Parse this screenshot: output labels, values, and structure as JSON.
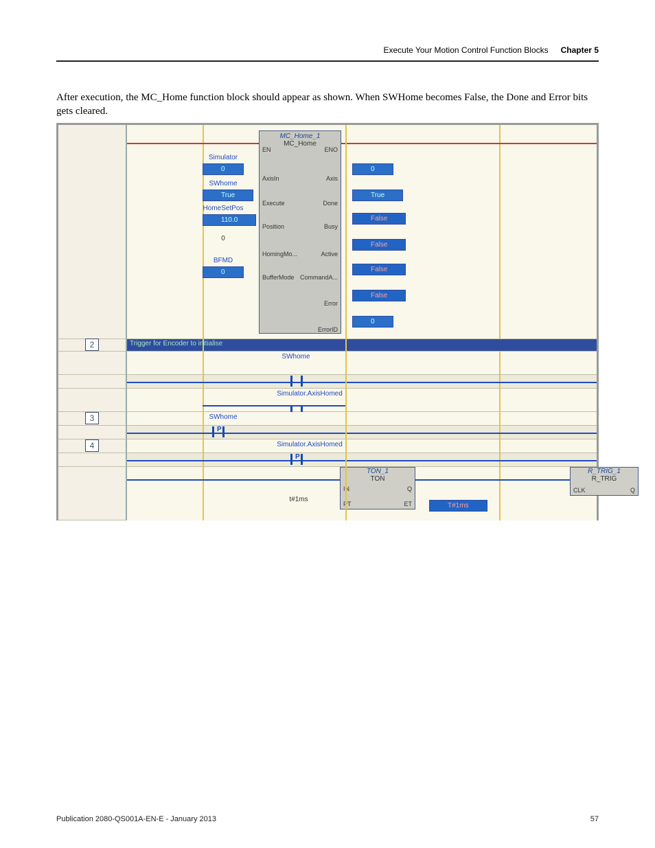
{
  "header": {
    "breadcrumb": "Execute Your Motion Control Function Blocks",
    "chapter": "Chapter 5"
  },
  "intro": "After execution, the MC_Home function block should appear as shown. When SWHome becomes False, the Done and Error bits gets cleared.",
  "mc_home": {
    "instance": "MC_Home_1",
    "type": "MC_Home",
    "ports_left": {
      "en": "EN",
      "axis": "AxisIn",
      "execute": "Execute",
      "position": "Position",
      "homing": "HomingMo...",
      "buffermode": "BufferMode"
    },
    "ports_right": {
      "eno": "ENO",
      "axis": "Axis",
      "done": "Done",
      "busy": "Busy",
      "active": "Active",
      "commanda": "CommandA...",
      "error": "Error",
      "errorid": "ErrorID"
    },
    "inputs": [
      {
        "label": "Simulator",
        "value": "0"
      },
      {
        "label": "SWhome",
        "value": "True"
      },
      {
        "label": "HomeSetPos",
        "value": "110.0"
      },
      {
        "label": "",
        "value": "0"
      },
      {
        "label": "BFMD",
        "value": "0"
      }
    ],
    "outputs": [
      {
        "value": "0"
      },
      {
        "value": "True"
      },
      {
        "value": "False"
      },
      {
        "value": "False"
      },
      {
        "value": "False"
      },
      {
        "value": "False"
      },
      {
        "value": "0"
      }
    ]
  },
  "rung2": {
    "num": "2",
    "note": "Trigger for Encoder to initialise",
    "contact1": "SWhome",
    "contact2": "Simulator.AxisHomed"
  },
  "rung3": {
    "num": "3",
    "contact": "SWhome"
  },
  "rung4": {
    "num": "4",
    "contact": "Simulator.AxisHomed",
    "tonInstance": "TON_1",
    "tonType": "TON",
    "tonPorts": {
      "in": "IN",
      "q": "Q",
      "pt": "PT",
      "et": "ET"
    },
    "ptVal": "t#1ms",
    "etVal": "T#1ms",
    "rtrigInstance": "R_TRIG_1",
    "rtrigType": "R_TRIG",
    "rtrigPorts": {
      "clk": "CLK",
      "q": "Q"
    }
  },
  "footer": {
    "pub": "Publication 2080-QS001A-EN-E - January 2013",
    "page": "57"
  }
}
